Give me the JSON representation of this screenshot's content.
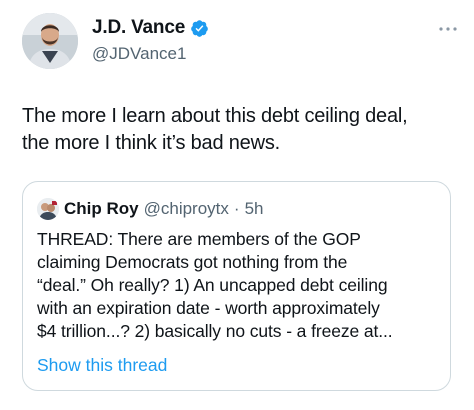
{
  "author": {
    "display_name": "J.D. Vance",
    "handle": "@JDVance1",
    "verified": true
  },
  "tweet": {
    "text_line1": "The more I learn about this debt ceiling deal,",
    "text_line2": "the more I think it’s bad news."
  },
  "quoted_tweet": {
    "display_name": "Chip Roy",
    "handle": "@chiproytx",
    "separator": "·",
    "time": "5h",
    "lines": [
      "THREAD:  There are members of the GOP",
      "claiming Democrats got nothing from the",
      "“deal.”  Oh really? 1) An uncapped debt ceiling",
      "with an expiration date - worth approximately",
      "$4 trillion...? 2) basically no cuts - a freeze at..."
    ],
    "show_thread_label": "Show this thread"
  },
  "colors": {
    "text": "#0f1419",
    "secondary": "#536471",
    "link": "#1d9bf0",
    "border": "#cfd9de"
  },
  "icons": {
    "verified": "verified-badge-icon",
    "more": "more-options-icon"
  }
}
